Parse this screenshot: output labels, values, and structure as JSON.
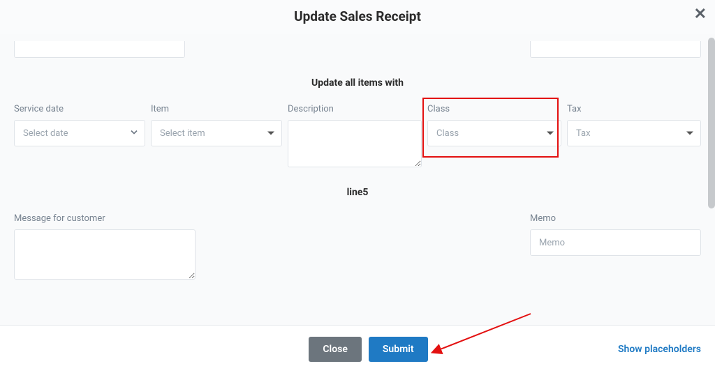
{
  "header": {
    "title": "Update Sales Receipt"
  },
  "section1": {
    "title": "Update all items with",
    "service_date": {
      "label": "Service date",
      "placeholder": "Select date"
    },
    "item": {
      "label": "Item",
      "placeholder": "Select item"
    },
    "description": {
      "label": "Description"
    },
    "class": {
      "label": "Class",
      "placeholder": "Class"
    },
    "tax": {
      "label": "Tax",
      "placeholder": "Tax"
    }
  },
  "section2": {
    "title": "line5",
    "message": {
      "label": "Message for customer"
    },
    "memo": {
      "label": "Memo",
      "placeholder": "Memo"
    }
  },
  "footer": {
    "close": "Close",
    "submit": "Submit",
    "show_placeholders": "Show placeholders"
  }
}
